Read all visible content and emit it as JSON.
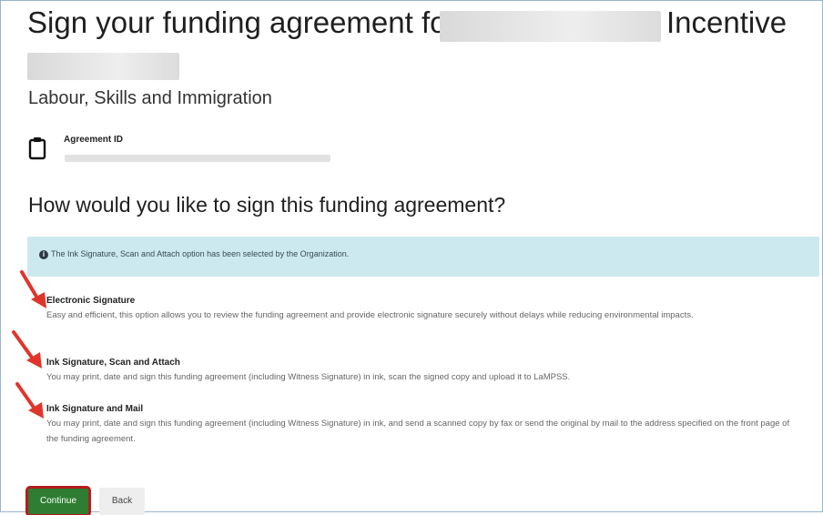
{
  "header": {
    "title_prefix": "Sign your funding agreement for",
    "title_suffix": "Incentive",
    "ministry": "Labour, Skills and Immigration"
  },
  "agreement": {
    "label": "Agreement ID",
    "icon": "clipboard-icon"
  },
  "question": "How would you like to sign this funding agreement?",
  "alert": {
    "icon": "info-icon",
    "text": "The Ink Signature, Scan and Attach option has been selected by the Organization."
  },
  "options": [
    {
      "title": "Electronic Signature",
      "description": "Easy and efficient, this option allows you to review the funding agreement and provide electronic signature securely without delays while reducing environmental impacts."
    },
    {
      "title": "Ink Signature, Scan and Attach",
      "description": "You may print, date and sign this funding agreement (including Witness Signature) in ink, scan the signed copy and upload it to LaMPSS."
    },
    {
      "title": "Ink Signature and Mail",
      "description": "You may print, date and sign this funding agreement (including Witness Signature) in ink, and send a scanned copy by fax or send the original by mail to the address specified on the front page of the funding agreement."
    }
  ],
  "buttons": {
    "continue": "Continue",
    "back": "Back"
  },
  "colors": {
    "alert_bg": "#cde9f0",
    "continue_bg": "#2e7d32",
    "annotation_red": "#e0352b"
  }
}
